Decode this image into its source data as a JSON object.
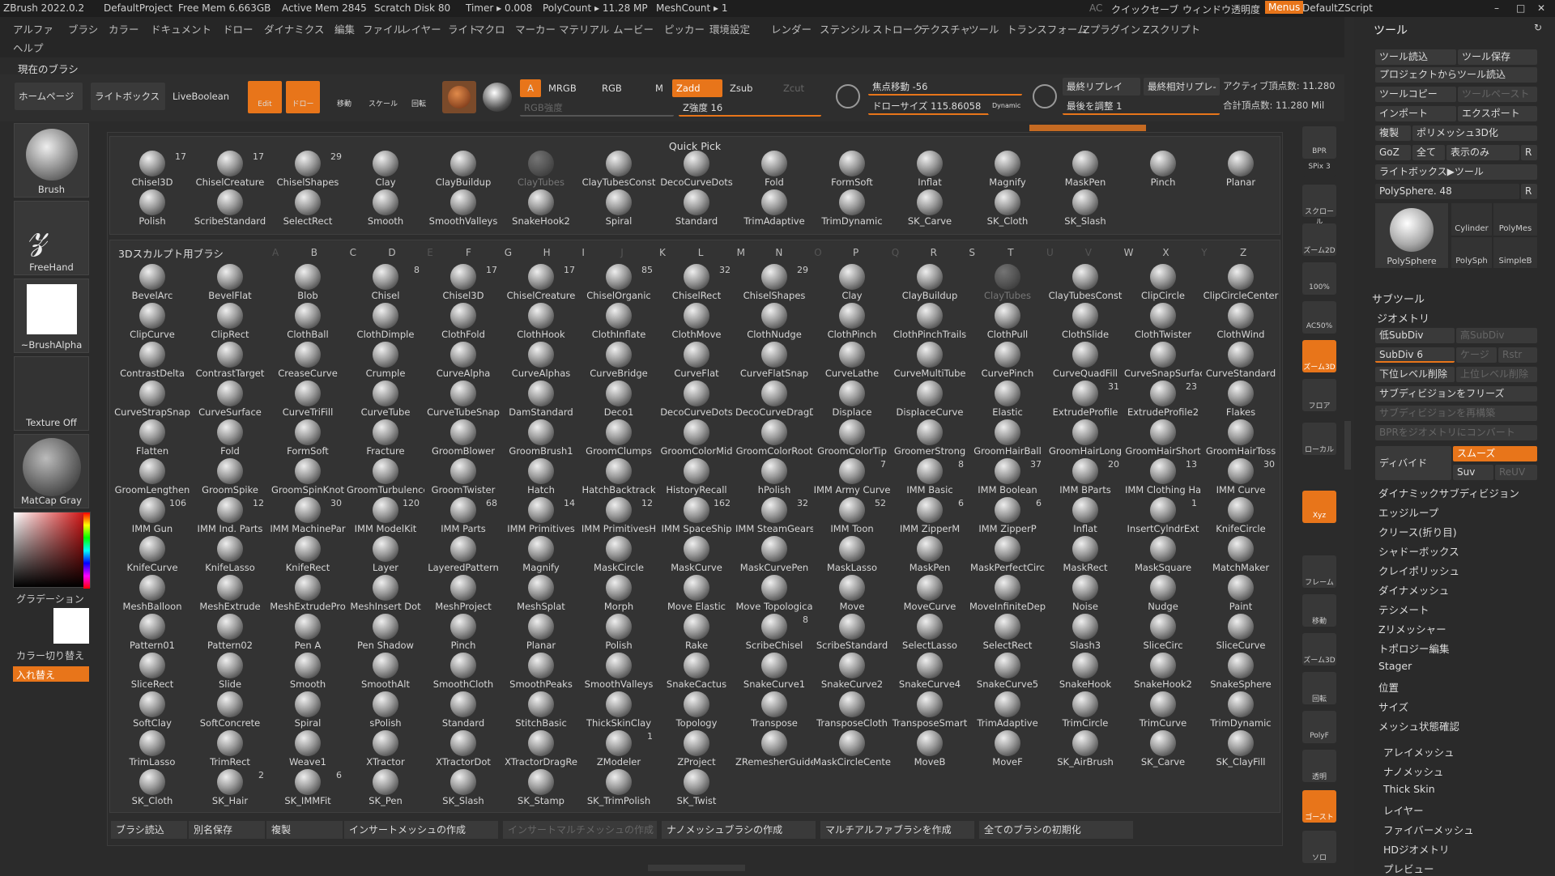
{
  "titlebar": {
    "app": "ZBrush 2022.0.2",
    "project": "DefaultProject",
    "free_mem": "Free Mem 6.663GB",
    "active_mem": "Active Mem 2845",
    "scratch": "Scratch Disk 80",
    "timer": "Timer ▸ 0.008",
    "polycount": "PolyCount ▸ 11.28 MP",
    "meshcount": "MeshCount ▸ 1",
    "ac": "AC",
    "quicksave": "クイックセーブ",
    "transparency": "ウィンドウ透明度",
    "menus": "Menus",
    "script": "DefaultZScript"
  },
  "menubar": [
    "アルファ",
    "ブラシ",
    "カラー",
    "ドキュメント",
    "ドロー",
    "ダイナミクス",
    "編集",
    "ファイル",
    "レイヤー",
    "ライト",
    "マクロ",
    "マーカー",
    "マテリアル",
    "ムービー",
    "ピッカー",
    "環境設定",
    "レンダー",
    "ステンシル",
    "ストローク",
    "テクスチャ",
    "ツール",
    "トランスフォーム",
    "Zプラグイン",
    "Zスクリプト"
  ],
  "menubar2": [
    "ヘルプ"
  ],
  "current_brush": "現在のブラシ",
  "toolbar": {
    "home": "ホームページ",
    "lightbox": "ライトボックス",
    "liveboolean": "LiveBoolean",
    "edit": "Edit",
    "draw": "ドロー",
    "move": "移動",
    "scale": "スケール",
    "rotate": "回転",
    "a": "A",
    "mrgb": "MRGB",
    "rgb": "RGB",
    "m": "M",
    "zadd": "Zadd",
    "zsub": "Zsub",
    "zcut": "Zcut",
    "rgb_intensity": "RGB強度",
    "z_intensity": "Z強度 16",
    "focal_shift": "焦点移動 -56",
    "draw_size": "ドローサイズ 115.86058",
    "dynamic": "Dynamic",
    "last_replay": "最終リプレイ",
    "last_rel_replay": "最終相対リプレ-",
    "adjust_last": "最後を調整 1",
    "active_points": "アクティブ頂点数: 11.280",
    "total_points": "合計頂点数: 11.280 Mil"
  },
  "left_shelf": [
    {
      "label": "Brush"
    },
    {
      "label": "FreeHand"
    },
    {
      "label": "~BrushAlpha"
    },
    {
      "label": "Texture Off"
    },
    {
      "label": "MatCap Gray"
    }
  ],
  "gradient_label": "グラデーション",
  "color_switch": "カラー切り替え",
  "swap": "入れ替え",
  "quick_pick": {
    "title": "Quick Pick",
    "row1": [
      {
        "n": "Chisel3D",
        "c": "17"
      },
      {
        "n": "ChiselCreature",
        "c": "17"
      },
      {
        "n": "ChiselShapes",
        "c": "29"
      },
      {
        "n": "Clay",
        "c": ""
      },
      {
        "n": "ClayBuildup",
        "c": ""
      },
      {
        "n": "ClayTubes",
        "c": ""
      },
      {
        "n": "ClayTubesConst",
        "c": ""
      },
      {
        "n": "DecoCurveDots",
        "c": ""
      },
      {
        "n": "Fold",
        "c": ""
      },
      {
        "n": "FormSoft",
        "c": ""
      },
      {
        "n": "Inflat",
        "c": ""
      },
      {
        "n": "Magnify",
        "c": ""
      },
      {
        "n": "MaskPen",
        "c": ""
      },
      {
        "n": "Pinch",
        "c": ""
      },
      {
        "n": "Planar",
        "c": ""
      }
    ],
    "row2": [
      {
        "n": "Polish",
        "c": ""
      },
      {
        "n": "ScribeStandard",
        "c": ""
      },
      {
        "n": "SelectRect",
        "c": ""
      },
      {
        "n": "Smooth",
        "c": ""
      },
      {
        "n": "SmoothValleys",
        "c": ""
      },
      {
        "n": "SnakeHook2",
        "c": ""
      },
      {
        "n": "Spiral",
        "c": ""
      },
      {
        "n": "Standard",
        "c": ""
      },
      {
        "n": "TrimAdaptive",
        "c": ""
      },
      {
        "n": "TrimDynamic",
        "c": ""
      },
      {
        "n": "SK_Carve",
        "c": ""
      },
      {
        "n": "SK_Cloth",
        "c": ""
      },
      {
        "n": "SK_Slash",
        "c": ""
      }
    ]
  },
  "sculpt": {
    "title": "3Dスカルプト用ブラシ",
    "alphabet": [
      "A",
      "B",
      "C",
      "D",
      "E",
      "F",
      "G",
      "H",
      "I",
      "J",
      "K",
      "L",
      "M",
      "N",
      "O",
      "P",
      "Q",
      "R",
      "S",
      "T",
      "U",
      "V",
      "W",
      "X",
      "Y",
      "Z"
    ],
    "brushes": [
      {
        "n": "BevelArc",
        "c": ""
      },
      {
        "n": "BevelFlat",
        "c": ""
      },
      {
        "n": "Blob",
        "c": ""
      },
      {
        "n": "Chisel",
        "c": "8"
      },
      {
        "n": "Chisel3D",
        "c": "17"
      },
      {
        "n": "ChiselCreature",
        "c": "17"
      },
      {
        "n": "ChiselOrganic",
        "c": "85"
      },
      {
        "n": "ChiselRect",
        "c": "32"
      },
      {
        "n": "ChiselShapes",
        "c": "29"
      },
      {
        "n": "Clay",
        "c": ""
      },
      {
        "n": "ClayBuildup",
        "c": ""
      },
      {
        "n": "ClayTubes",
        "c": ""
      },
      {
        "n": "ClayTubesConst",
        "c": ""
      },
      {
        "n": "ClipCircle",
        "c": ""
      },
      {
        "n": "ClipCircleCenter",
        "c": ""
      },
      {
        "n": "ClipCurve",
        "c": ""
      },
      {
        "n": "ClipRect",
        "c": ""
      },
      {
        "n": "ClothBall",
        "c": ""
      },
      {
        "n": "ClothDimple",
        "c": ""
      },
      {
        "n": "ClothFold",
        "c": ""
      },
      {
        "n": "ClothHook",
        "c": ""
      },
      {
        "n": "ClothInflate",
        "c": ""
      },
      {
        "n": "ClothMove",
        "c": ""
      },
      {
        "n": "ClothNudge",
        "c": ""
      },
      {
        "n": "ClothPinch",
        "c": ""
      },
      {
        "n": "ClothPinchTrails",
        "c": ""
      },
      {
        "n": "ClothPull",
        "c": ""
      },
      {
        "n": "ClothSlide",
        "c": ""
      },
      {
        "n": "ClothTwister",
        "c": ""
      },
      {
        "n": "ClothWind",
        "c": ""
      },
      {
        "n": "ContrastDelta",
        "c": ""
      },
      {
        "n": "ContrastTarget",
        "c": ""
      },
      {
        "n": "CreaseCurve",
        "c": ""
      },
      {
        "n": "Crumple",
        "c": ""
      },
      {
        "n": "CurveAlpha",
        "c": ""
      },
      {
        "n": "CurveAlphas",
        "c": ""
      },
      {
        "n": "CurveBridge",
        "c": ""
      },
      {
        "n": "CurveFlat",
        "c": ""
      },
      {
        "n": "CurveFlatSnap",
        "c": ""
      },
      {
        "n": "CurveLathe",
        "c": ""
      },
      {
        "n": "CurveMultiTube",
        "c": ""
      },
      {
        "n": "CurvePinch",
        "c": ""
      },
      {
        "n": "CurveQuadFill",
        "c": ""
      },
      {
        "n": "CurveSnapSurface",
        "c": ""
      },
      {
        "n": "CurveStandard",
        "c": ""
      },
      {
        "n": "CurveStrapSnap",
        "c": ""
      },
      {
        "n": "CurveSurface",
        "c": ""
      },
      {
        "n": "CurveTriFill",
        "c": ""
      },
      {
        "n": "CurveTube",
        "c": ""
      },
      {
        "n": "CurveTubeSnap",
        "c": ""
      },
      {
        "n": "DamStandard",
        "c": ""
      },
      {
        "n": "Deco1",
        "c": ""
      },
      {
        "n": "DecoCurveDots",
        "c": ""
      },
      {
        "n": "DecoCurveDragDots",
        "c": ""
      },
      {
        "n": "Displace",
        "c": ""
      },
      {
        "n": "DisplaceCurve",
        "c": ""
      },
      {
        "n": "Elastic",
        "c": ""
      },
      {
        "n": "ExtrudeProfile",
        "c": "31"
      },
      {
        "n": "ExtrudeProfile2",
        "c": "23"
      },
      {
        "n": "Flakes",
        "c": ""
      },
      {
        "n": "Flatten",
        "c": ""
      },
      {
        "n": "Fold",
        "c": ""
      },
      {
        "n": "FormSoft",
        "c": ""
      },
      {
        "n": "Fracture",
        "c": ""
      },
      {
        "n": "GroomBlower",
        "c": ""
      },
      {
        "n": "GroomBrush1",
        "c": ""
      },
      {
        "n": "GroomClumps",
        "c": ""
      },
      {
        "n": "GroomColorMid",
        "c": ""
      },
      {
        "n": "GroomColorRoot",
        "c": ""
      },
      {
        "n": "GroomColorTip",
        "c": ""
      },
      {
        "n": "GroomerStrong",
        "c": ""
      },
      {
        "n": "GroomHairBall",
        "c": ""
      },
      {
        "n": "GroomHairLong",
        "c": ""
      },
      {
        "n": "GroomHairShort",
        "c": ""
      },
      {
        "n": "GroomHairToss",
        "c": ""
      },
      {
        "n": "GroomLengthen",
        "c": ""
      },
      {
        "n": "GroomSpike",
        "c": ""
      },
      {
        "n": "GroomSpinKnot",
        "c": ""
      },
      {
        "n": "GroomTurbulence",
        "c": ""
      },
      {
        "n": "GroomTwister",
        "c": ""
      },
      {
        "n": "Hatch",
        "c": ""
      },
      {
        "n": "HatchBacktrack",
        "c": ""
      },
      {
        "n": "HistoryRecall",
        "c": ""
      },
      {
        "n": "hPolish",
        "c": ""
      },
      {
        "n": "IMM Army Curve",
        "c": "7"
      },
      {
        "n": "IMM Basic",
        "c": "8"
      },
      {
        "n": "IMM Boolean",
        "c": "37"
      },
      {
        "n": "IMM BParts",
        "c": "20"
      },
      {
        "n": "IMM Clothing Ha",
        "c": "13"
      },
      {
        "n": "IMM Curve",
        "c": "30"
      },
      {
        "n": "IMM Gun",
        "c": "106"
      },
      {
        "n": "IMM Ind. Parts",
        "c": "12"
      },
      {
        "n": "IMM MachinePar",
        "c": "30"
      },
      {
        "n": "IMM ModelKit",
        "c": "120"
      },
      {
        "n": "IMM Parts",
        "c": "68"
      },
      {
        "n": "IMM Primitives",
        "c": "14"
      },
      {
        "n": "IMM PrimitivesH",
        "c": "12"
      },
      {
        "n": "IMM SpaceShip",
        "c": "162"
      },
      {
        "n": "IMM SteamGears",
        "c": "32"
      },
      {
        "n": "IMM Toon",
        "c": "52"
      },
      {
        "n": "IMM ZipperM",
        "c": "6"
      },
      {
        "n": "IMM ZipperP",
        "c": "6"
      },
      {
        "n": "Inflat",
        "c": ""
      },
      {
        "n": "InsertCylndrExt",
        "c": "1"
      },
      {
        "n": "KnifeCircle",
        "c": ""
      },
      {
        "n": "KnifeCurve",
        "c": ""
      },
      {
        "n": "KnifeLasso",
        "c": ""
      },
      {
        "n": "KnifeRect",
        "c": ""
      },
      {
        "n": "Layer",
        "c": ""
      },
      {
        "n": "LayeredPattern",
        "c": ""
      },
      {
        "n": "Magnify",
        "c": ""
      },
      {
        "n": "MaskCircle",
        "c": ""
      },
      {
        "n": "MaskCurve",
        "c": ""
      },
      {
        "n": "MaskCurvePen",
        "c": ""
      },
      {
        "n": "MaskLasso",
        "c": ""
      },
      {
        "n": "MaskPen",
        "c": ""
      },
      {
        "n": "MaskPerfectCirc",
        "c": ""
      },
      {
        "n": "MaskRect",
        "c": ""
      },
      {
        "n": "MaskSquare",
        "c": ""
      },
      {
        "n": "MatchMaker",
        "c": ""
      },
      {
        "n": "MeshBalloon",
        "c": ""
      },
      {
        "n": "MeshExtrude",
        "c": ""
      },
      {
        "n": "MeshExtrudePro",
        "c": ""
      },
      {
        "n": "MeshInsert Dot",
        "c": ""
      },
      {
        "n": "MeshProject",
        "c": ""
      },
      {
        "n": "MeshSplat",
        "c": ""
      },
      {
        "n": "Morph",
        "c": ""
      },
      {
        "n": "Move Elastic",
        "c": ""
      },
      {
        "n": "Move Topologica",
        "c": ""
      },
      {
        "n": "Move",
        "c": ""
      },
      {
        "n": "MoveCurve",
        "c": ""
      },
      {
        "n": "MoveInfiniteDep",
        "c": ""
      },
      {
        "n": "Noise",
        "c": ""
      },
      {
        "n": "Nudge",
        "c": ""
      },
      {
        "n": "Paint",
        "c": ""
      },
      {
        "n": "Pattern01",
        "c": ""
      },
      {
        "n": "Pattern02",
        "c": ""
      },
      {
        "n": "Pen A",
        "c": ""
      },
      {
        "n": "Pen Shadow",
        "c": ""
      },
      {
        "n": "Pinch",
        "c": ""
      },
      {
        "n": "Planar",
        "c": ""
      },
      {
        "n": "Polish",
        "c": ""
      },
      {
        "n": "Rake",
        "c": ""
      },
      {
        "n": "ScribeChisel",
        "c": "8"
      },
      {
        "n": "ScribeStandard",
        "c": ""
      },
      {
        "n": "SelectLasso",
        "c": ""
      },
      {
        "n": "SelectRect",
        "c": ""
      },
      {
        "n": "Slash3",
        "c": ""
      },
      {
        "n": "SliceCirc",
        "c": ""
      },
      {
        "n": "SliceCurve",
        "c": ""
      },
      {
        "n": "SliceRect",
        "c": ""
      },
      {
        "n": "Slide",
        "c": ""
      },
      {
        "n": "Smooth",
        "c": ""
      },
      {
        "n": "SmoothAlt",
        "c": ""
      },
      {
        "n": "SmoothCloth",
        "c": ""
      },
      {
        "n": "SmoothPeaks",
        "c": ""
      },
      {
        "n": "SmoothValleys",
        "c": ""
      },
      {
        "n": "SnakeCactus",
        "c": ""
      },
      {
        "n": "SnakeCurve1",
        "c": ""
      },
      {
        "n": "SnakeCurve2",
        "c": ""
      },
      {
        "n": "SnakeCurve4",
        "c": ""
      },
      {
        "n": "SnakeCurve5",
        "c": ""
      },
      {
        "n": "SnakeHook",
        "c": ""
      },
      {
        "n": "SnakeHook2",
        "c": ""
      },
      {
        "n": "SnakeSphere",
        "c": ""
      },
      {
        "n": "SoftClay",
        "c": ""
      },
      {
        "n": "SoftConcrete",
        "c": ""
      },
      {
        "n": "Spiral",
        "c": ""
      },
      {
        "n": "sPolish",
        "c": ""
      },
      {
        "n": "Standard",
        "c": ""
      },
      {
        "n": "StitchBasic",
        "c": ""
      },
      {
        "n": "ThickSkinClay",
        "c": ""
      },
      {
        "n": "Topology",
        "c": ""
      },
      {
        "n": "Transpose",
        "c": ""
      },
      {
        "n": "TransposeCloth",
        "c": ""
      },
      {
        "n": "TransposeSmart",
        "c": ""
      },
      {
        "n": "TrimAdaptive",
        "c": ""
      },
      {
        "n": "TrimCircle",
        "c": ""
      },
      {
        "n": "TrimCurve",
        "c": ""
      },
      {
        "n": "TrimDynamic",
        "c": ""
      },
      {
        "n": "TrimLasso",
        "c": ""
      },
      {
        "n": "TrimRect",
        "c": ""
      },
      {
        "n": "Weave1",
        "c": ""
      },
      {
        "n": "XTractor",
        "c": ""
      },
      {
        "n": "XTractorDot",
        "c": ""
      },
      {
        "n": "XTractorDragRe",
        "c": ""
      },
      {
        "n": "ZModeler",
        "c": "1"
      },
      {
        "n": "ZProject",
        "c": ""
      },
      {
        "n": "ZRemesherGuide",
        "c": ""
      },
      {
        "n": "MaskCircleCente",
        "c": ""
      },
      {
        "n": "MoveB",
        "c": ""
      },
      {
        "n": "MoveF",
        "c": ""
      },
      {
        "n": "SK_AirBrush",
        "c": ""
      },
      {
        "n": "SK_Carve",
        "c": ""
      },
      {
        "n": "SK_ClayFill",
        "c": ""
      },
      {
        "n": "SK_Cloth",
        "c": ""
      },
      {
        "n": "SK_Hair",
        "c": "2"
      },
      {
        "n": "SK_IMMFit",
        "c": "6"
      },
      {
        "n": "SK_Pen",
        "c": ""
      },
      {
        "n": "SK_Slash",
        "c": ""
      },
      {
        "n": "SK_Stamp",
        "c": ""
      },
      {
        "n": "SK_TrimPolish",
        "c": ""
      },
      {
        "n": "SK_Twist",
        "c": ""
      }
    ]
  },
  "bottom_buttons": [
    "ブラシ読込",
    "別名保存",
    "複製",
    "インサートメッシュの作成",
    "インサートマルチメッシュの作成",
    "ナノメッシュブラシの作成",
    "マルチアルファブラシを作成",
    "全てのブラシの初期化"
  ],
  "right_shelf": [
    "BPR",
    "SPix 3",
    "スクロール",
    "ズーム2D",
    "100%",
    "AC50%",
    "ズーム3D",
    "フロア",
    "ローカル",
    "Xyz",
    "フレーム",
    "移動",
    "ズーム3D",
    "回転",
    "Line Fill",
    "PolyF",
    "透明",
    "ゴースト",
    "Dynamic",
    "ソロ"
  ],
  "tool_panel": {
    "title": "ツール",
    "buttons": [
      "ツール読込",
      "ツール保存",
      "プロジェクトからツール読込",
      "ツールコピー",
      "ツールペースト",
      "インポート",
      "エクスポート",
      "複製",
      "ポリメッシュ3D化",
      "GoZ",
      "全て",
      "表示のみ",
      "R",
      "ライトボックス▶ツール",
      "PolySphere. 48",
      "R"
    ],
    "thumbs": [
      "PolySphere",
      "Cylinder",
      "PolyMes",
      "PolySph",
      "SimpleB"
    ],
    "subtool": "サブツール",
    "geometry": "ジオメトリ",
    "lower_subdiv": "低SubDiv",
    "higher_subdiv": "高SubDiv",
    "subdiv": "SubDiv 6",
    "cage": "ケージ",
    "rstr": "Rstr",
    "freeze_lower": "下位レベル削除",
    "freeze_higher": "上位レベル削除",
    "freeze_subdiv": "サブディビジョンをフリーズ",
    "reconstruct": "サブディビジョンを再構築",
    "bpr_convert": "BPRをジオメトリにコンバート",
    "divide": "ディバイド",
    "smooth": "スムーズ",
    "suv": "Suv",
    "reuv": "ReUV",
    "items": [
      "ダイナミックサブディビジョン",
      "エッジループ",
      "クリース(折り目)",
      "シャドーボックス",
      "クレイポリッシュ",
      "ダイナメッシュ",
      "テシメート",
      "Zリメッシャー",
      "トポロジー編集",
      "Stager",
      "位置",
      "サイズ",
      "メッシュ状態確認"
    ],
    "items2": [
      "アレイメッシュ",
      "ナノメッシュ",
      "Thick Skin",
      "レイヤー",
      "ファイバーメッシュ",
      "HDジオメトリ",
      "プレビュー"
    ]
  }
}
